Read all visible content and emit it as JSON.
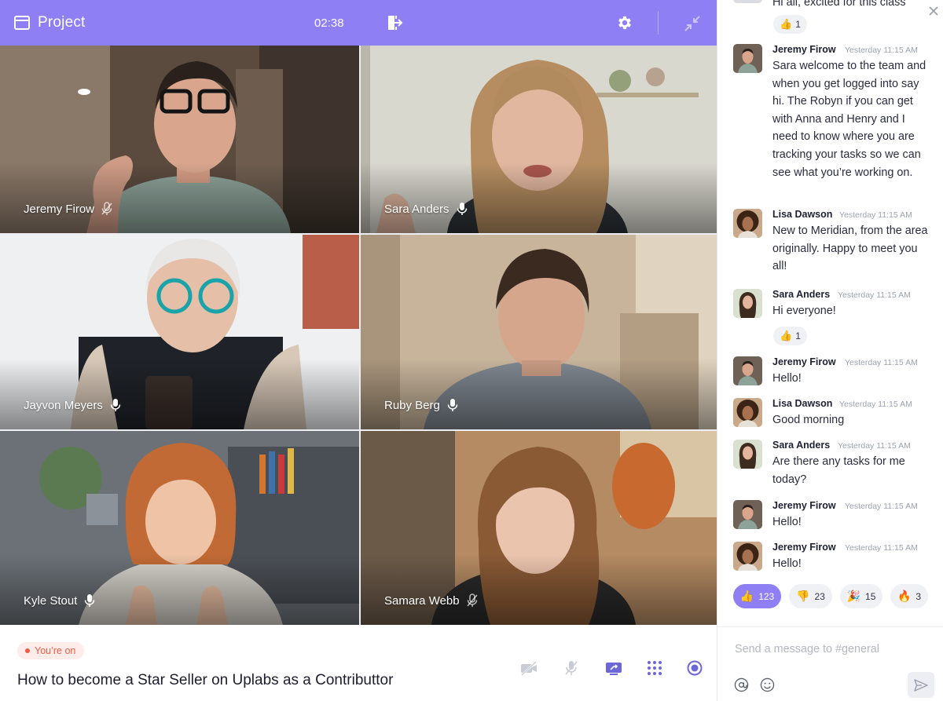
{
  "header": {
    "title": "Project",
    "timer": "02:38"
  },
  "participants": [
    {
      "name": "Jeremy Firow",
      "mic": "muted"
    },
    {
      "name": "Sara Anders",
      "mic": "on"
    },
    {
      "name": "Jayvon Meyers",
      "mic": "on"
    },
    {
      "name": "Ruby Berg",
      "mic": "on"
    },
    {
      "name": "Kyle Stout",
      "mic": "on"
    },
    {
      "name": "Samara Webb",
      "mic": "muted"
    }
  ],
  "bottom": {
    "live_badge": "You’re on",
    "session_title": "How to become a Star Seller on Uplabs as a Contributtor"
  },
  "chat": {
    "partial_message": "Hi all, excited for this class",
    "partial_reaction": {
      "emoji": "👍",
      "count": "1"
    },
    "messages": [
      {
        "author": "Jeremy Firow",
        "time": "Yesterday 11:15 AM",
        "text": "Sara welcome to the team and when you get logged into say hi. The Robyn if you can get with Anna and Henry and I need to know where you are tracking your tasks so we can see what you’re working on."
      },
      {
        "author": "Lisa Dawson",
        "time": "Yesterday 11:15 AM",
        "text": "New to Meridian, from the area originally. Happy to meet you all!"
      },
      {
        "author": "Sara Anders",
        "time": "Yesterday 11:15 AM",
        "text": "Hi everyone!",
        "reaction": {
          "emoji": "👍",
          "count": "1"
        }
      },
      {
        "author": "Jeremy Firow",
        "time": "Yesterday 11:15 AM",
        "text": "Hello!"
      },
      {
        "author": "Lisa Dawson",
        "time": "Yesterday 11:15 AM",
        "text": "Good morning"
      },
      {
        "author": "Sara Anders",
        "time": "Yesterday 11:15 AM",
        "text": "Are there any tasks for me today?"
      },
      {
        "author": "Jeremy Firow",
        "time": "Yesterday 11:15 AM",
        "text": "Hello!"
      },
      {
        "author": "Jeremy Firow",
        "time": "Yesterday 11:15 AM",
        "text": "Hello!"
      }
    ],
    "reactions_bar": [
      {
        "emoji": "👍",
        "count": "123",
        "selected": true
      },
      {
        "emoji": "👎",
        "count": "23",
        "selected": false
      },
      {
        "emoji": "🎉",
        "count": "15",
        "selected": false
      },
      {
        "emoji": "🔥",
        "count": "3",
        "selected": false
      }
    ],
    "composer_placeholder": "Send a message to #general"
  },
  "colors": {
    "accent": "#8f7ff5",
    "live": "#ef5b45",
    "active_speaker_border": "#7ed6a7"
  }
}
